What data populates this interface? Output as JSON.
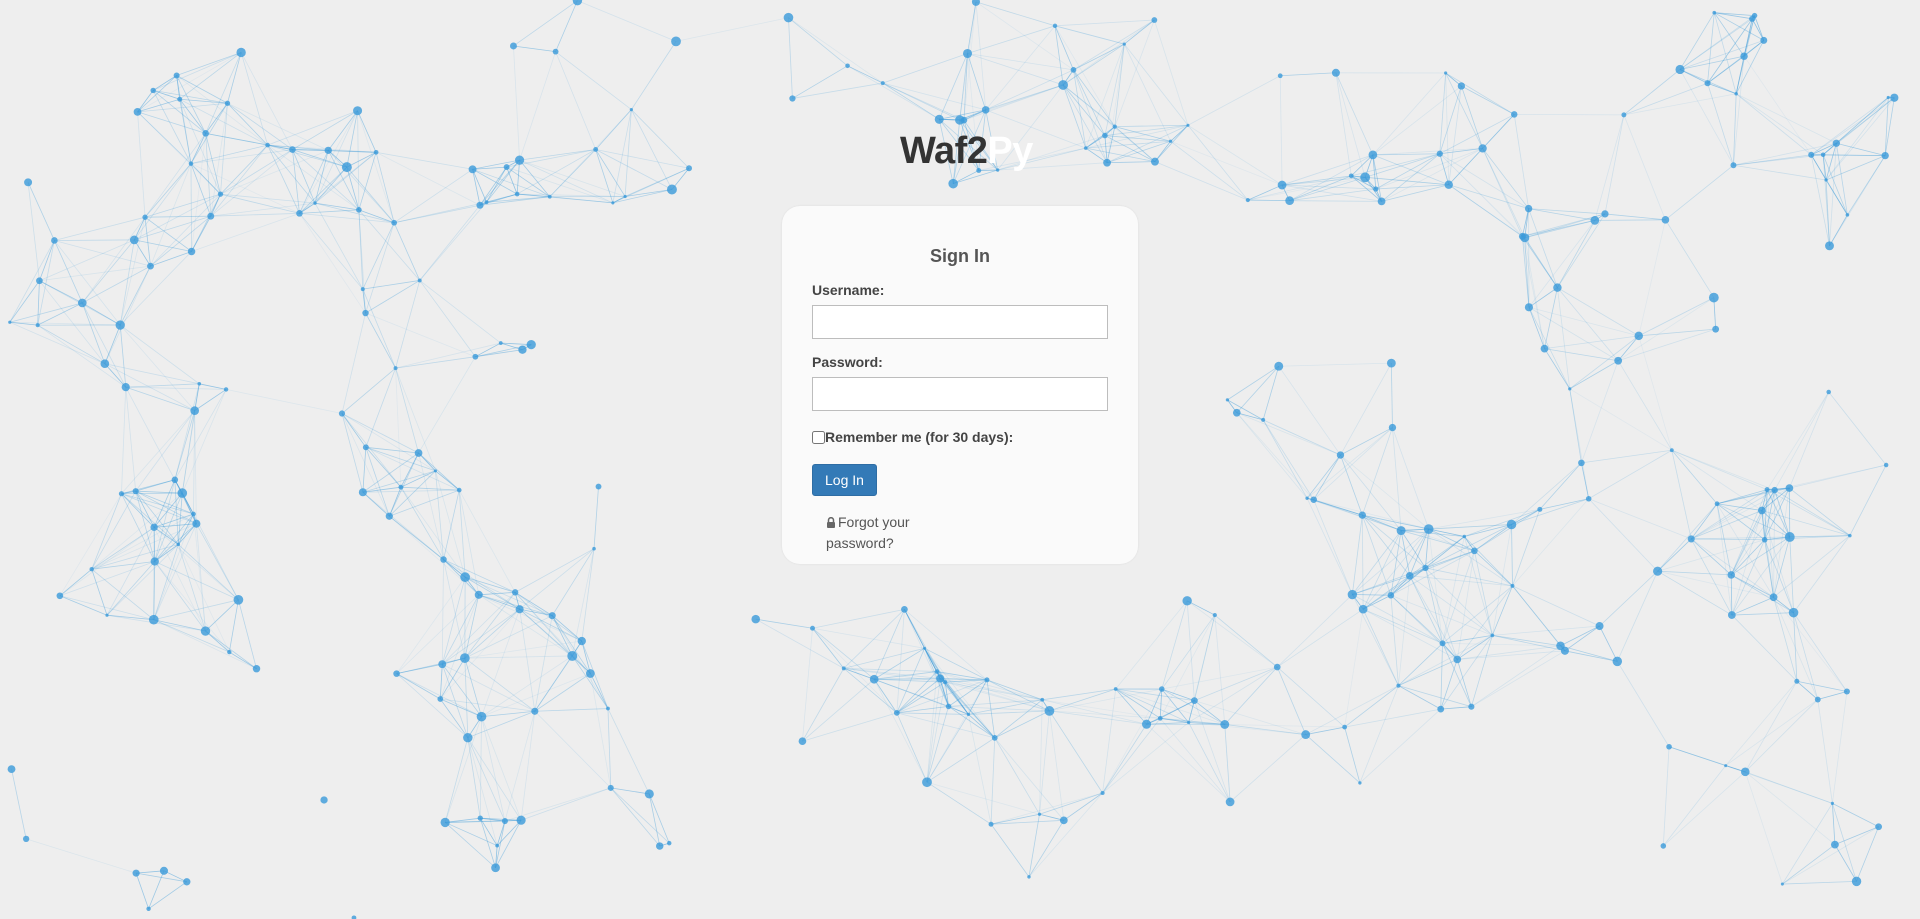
{
  "brand": {
    "main": "Waf2",
    "accent": "Py"
  },
  "login": {
    "title": "Sign In",
    "username_label": "Username:",
    "username_value": "",
    "password_label": "Password:",
    "password_value": "",
    "remember_label": "Remember me (for 30 days):",
    "remember_checked": false,
    "submit_label": "Log In",
    "forgot_label": "Forgot your password?"
  },
  "icons": {
    "forgot": "lock-icon"
  },
  "colors": {
    "background": "#eeeeee",
    "network": "#3a9ad9",
    "primary_button": "#337ab7",
    "card": "#fafafa"
  }
}
